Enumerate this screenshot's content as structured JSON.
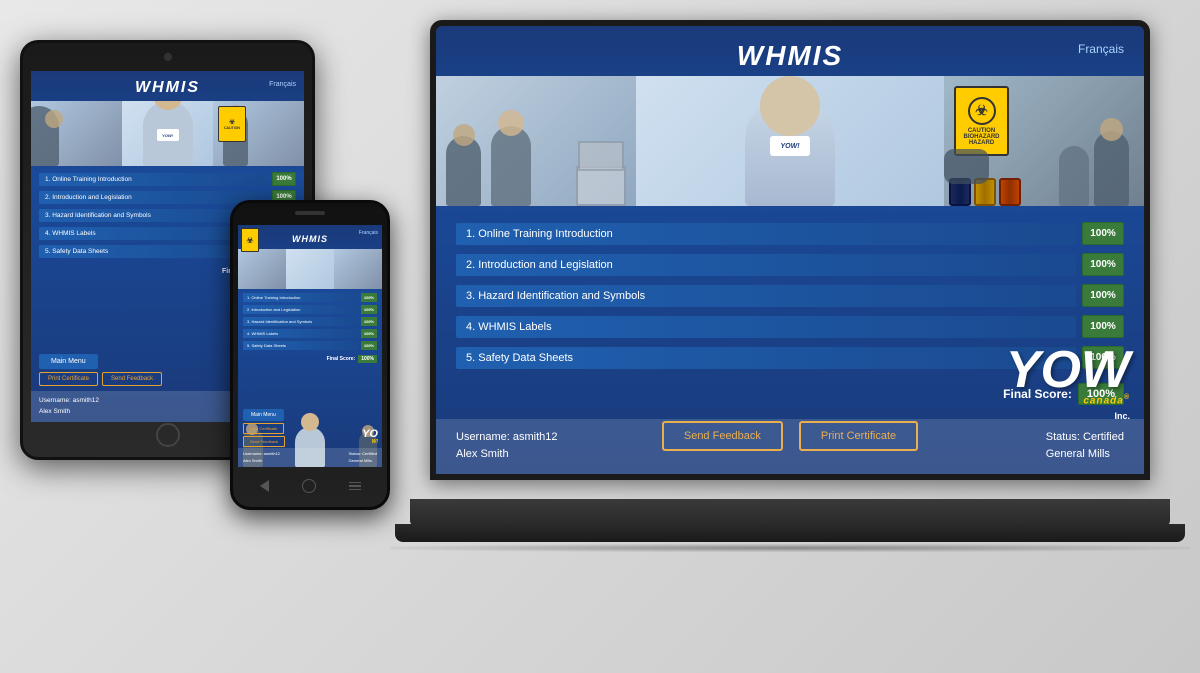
{
  "app": {
    "title": "WHMIS",
    "language_toggle": "Français"
  },
  "course_items": [
    {
      "id": 1,
      "label": "1. Online Training Introduction",
      "score": "100%"
    },
    {
      "id": 2,
      "label": "2. Introduction and Legislation",
      "score": "100%"
    },
    {
      "id": 3,
      "label": "3. Hazard Identification and Symbols",
      "score": "100%"
    },
    {
      "id": 4,
      "label": "4. WHMIS Labels",
      "score": "100%"
    },
    {
      "id": 5,
      "label": "5. Safety Data Sheets",
      "score": "100%"
    }
  ],
  "final_score": {
    "label": "Final Score:",
    "value": "100%"
  },
  "buttons": {
    "send_feedback": "Send Feedback",
    "print_certificate": "Print Certificate",
    "main_menu": "Main Menu"
  },
  "user": {
    "username_label": "Username: asmith12",
    "name": "Alex Smith",
    "status_label": "Status: Certified",
    "company": "General Mills"
  },
  "yow": {
    "text": "YOW",
    "canada": "canada",
    "registered": "®",
    "inc": "Inc."
  },
  "caution_sign": {
    "line1": "CAUTION",
    "line2": "BIOHAZARD",
    "line3": "HAZARD"
  }
}
